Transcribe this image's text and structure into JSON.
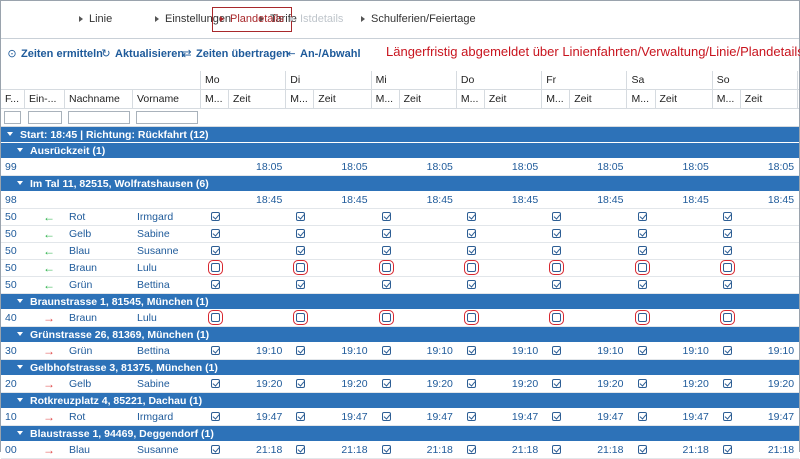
{
  "tabs": [
    {
      "label": "Linie",
      "state": "normal"
    },
    {
      "label": "Einstellungen",
      "state": "normal"
    },
    {
      "label": "Tarife",
      "state": "normal"
    },
    {
      "label": "Plandetails",
      "state": "active"
    },
    {
      "label": "Istdetails",
      "state": "disabled"
    },
    {
      "label": "Schulferien/Feiertage",
      "state": "normal"
    }
  ],
  "toolbar": {
    "zeiten_ermitteln": "Zeiten ermitteln",
    "aktualisieren": "Aktualisieren",
    "zeiten_uebertragen": "Zeiten übertragen",
    "an_abwahl": "An-/Abwahl",
    "notice": "Längerfristig abgemeldet über Linienfahrten/Verwaltung/Linie/Plandetails"
  },
  "columns": {
    "f": "F...",
    "ein": "Ein-...",
    "nachname": "Nachname",
    "vorname": "Vorname",
    "days": [
      "Mo",
      "Di",
      "Mi",
      "Do",
      "Fr",
      "Sa",
      "So"
    ],
    "mit": "M...",
    "zeit": "Zeit"
  },
  "colors": {
    "accent": "#2d72b8",
    "link": "#1e5a9a",
    "notice": "#c8141e",
    "highlight": "#d8262e",
    "arrow_in": "#2bb24a",
    "arrow_out": "#e04848"
  },
  "groups": [
    {
      "label": "Start: 18:45 | Richtung: Rückfahrt (12)",
      "level": 0
    },
    {
      "label": "Ausrückzeit (1)",
      "level": 1,
      "rows": [
        {
          "f": "99",
          "dir": "",
          "nachname": "",
          "vorname": "",
          "cb": "none",
          "time": "18:05"
        }
      ]
    },
    {
      "label": "Im Tal 11, 82515, Wolfratshausen (6)",
      "level": 1,
      "rows": [
        {
          "f": "98",
          "dir": "",
          "nachname": "",
          "vorname": "",
          "cb": "none",
          "time": "18:45"
        },
        {
          "f": "50",
          "dir": "in",
          "nachname": "Rot",
          "vorname": "Irmgard",
          "cb": "on",
          "time": ""
        },
        {
          "f": "50",
          "dir": "in",
          "nachname": "Gelb",
          "vorname": "Sabine",
          "cb": "on",
          "time": ""
        },
        {
          "f": "50",
          "dir": "in",
          "nachname": "Blau",
          "vorname": "Susanne",
          "cb": "on",
          "time": ""
        },
        {
          "f": "50",
          "dir": "in",
          "nachname": "Braun",
          "vorname": "Lulu",
          "cb": "off-hl",
          "time": ""
        },
        {
          "f": "50",
          "dir": "in",
          "nachname": "Grün",
          "vorname": "Bettina",
          "cb": "on",
          "time": ""
        }
      ]
    },
    {
      "label": "Braunstrasse 1, 81545, München (1)",
      "level": 1,
      "rows": [
        {
          "f": "40",
          "dir": "out",
          "nachname": "Braun",
          "vorname": "Lulu",
          "cb": "off-hl",
          "time": ""
        }
      ]
    },
    {
      "label": "Grünstrasse 26, 81369, München (1)",
      "level": 1,
      "rows": [
        {
          "f": "30",
          "dir": "out",
          "nachname": "Grün",
          "vorname": "Bettina",
          "cb": "on",
          "time": "19:10"
        }
      ]
    },
    {
      "label": "Gelbhofstrasse 3, 81375, München (1)",
      "level": 1,
      "rows": [
        {
          "f": "20",
          "dir": "out",
          "nachname": "Gelb",
          "vorname": "Sabine",
          "cb": "on",
          "time": "19:20"
        }
      ]
    },
    {
      "label": "Rotkreuzplatz 4, 85221, Dachau (1)",
      "level": 1,
      "rows": [
        {
          "f": "10",
          "dir": "out",
          "nachname": "Rot",
          "vorname": "Irmgard",
          "cb": "on",
          "time": "19:47"
        }
      ]
    },
    {
      "label": "Blaustrasse 1, 94469, Deggendorf (1)",
      "level": 1,
      "rows": [
        {
          "f": "00",
          "dir": "out",
          "nachname": "Blau",
          "vorname": "Susanne",
          "cb": "on",
          "time": "21:18"
        }
      ]
    }
  ]
}
